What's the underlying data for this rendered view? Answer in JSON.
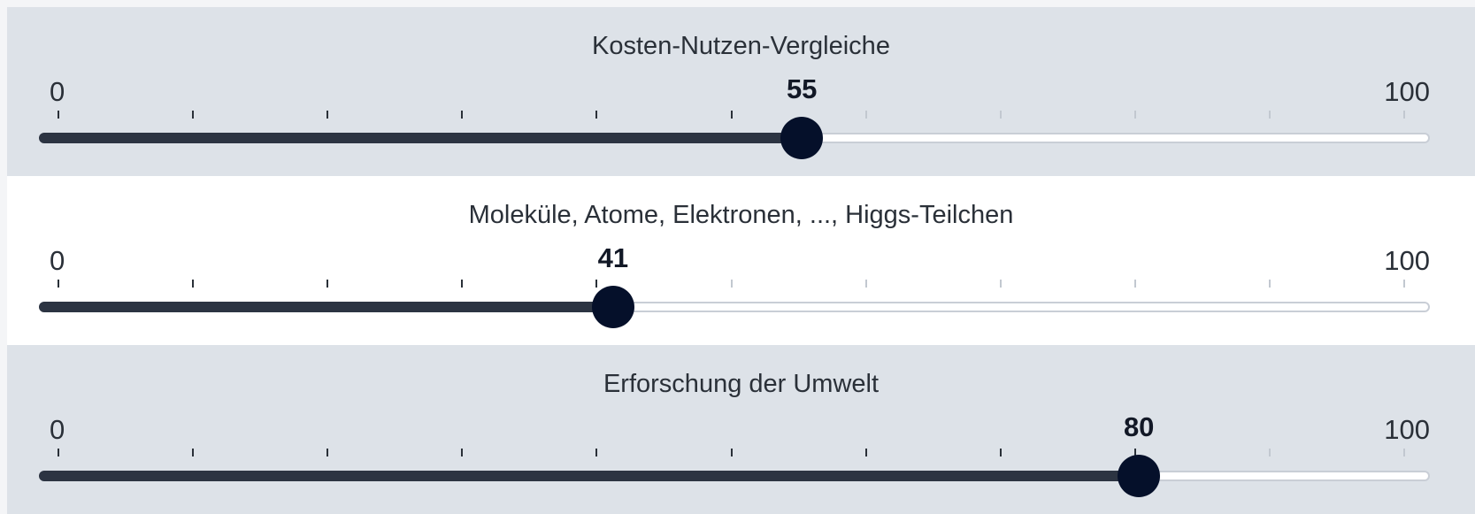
{
  "sliders": [
    {
      "title": "Kosten-Nutzen-Vergleiche",
      "min_label": "0",
      "max_label": "100",
      "min": 0,
      "max": 100,
      "value": 55,
      "value_label": "55",
      "background": "shaded"
    },
    {
      "title": "Moleküle, Atome, Elektronen, ..., Higgs-Teilchen",
      "min_label": "0",
      "max_label": "100",
      "min": 0,
      "max": 100,
      "value": 41,
      "value_label": "41",
      "background": "plain"
    },
    {
      "title": "Erforschung der Umwelt",
      "min_label": "0",
      "max_label": "100",
      "min": 0,
      "max": 100,
      "value": 80,
      "value_label": "80",
      "background": "shaded"
    }
  ],
  "tick_step": 10,
  "colors": {
    "panel_shaded": "#dde2e8",
    "panel_plain": "#ffffff",
    "track_fill": "#2c3442",
    "thumb": "#05102a",
    "track_empty": "#ffffff",
    "tick_active": "#2a3038",
    "tick_faint": "#c2c8d0"
  }
}
